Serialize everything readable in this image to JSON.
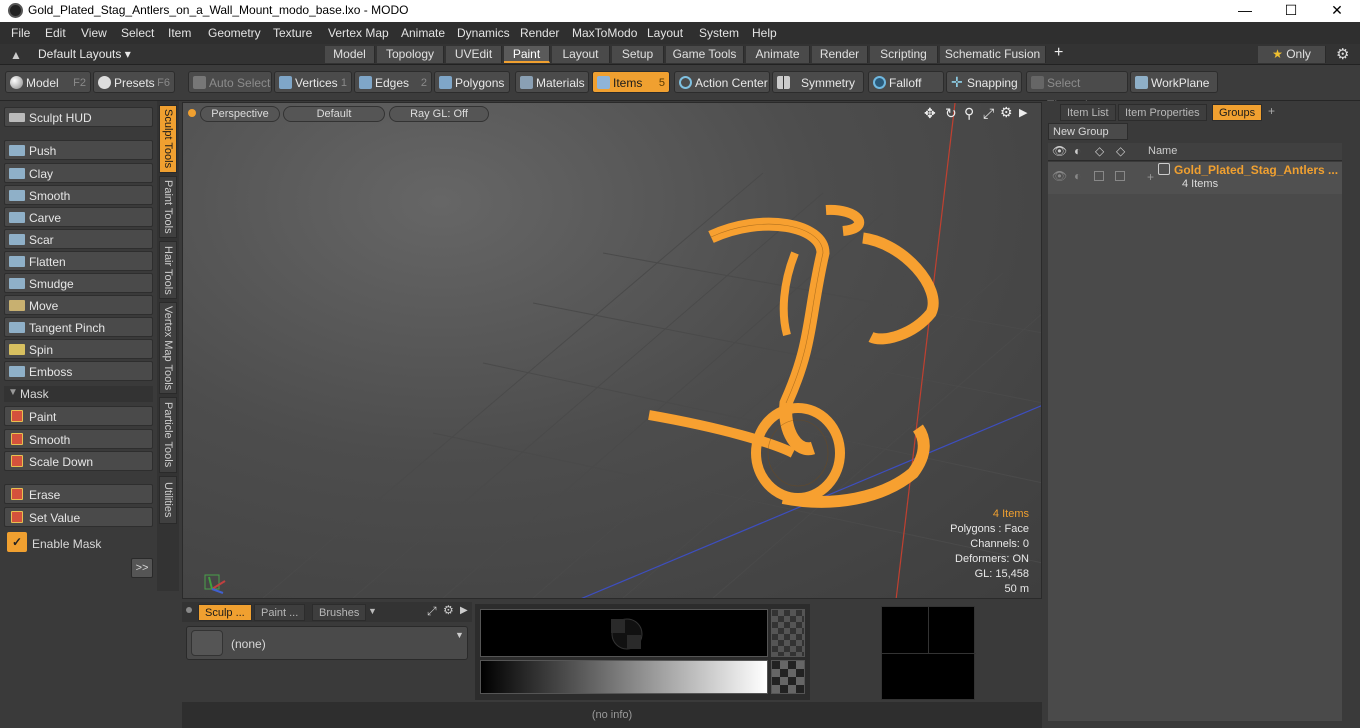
{
  "window": {
    "title": "Gold_Plated_Stag_Antlers_on_a_Wall_Mount_modo_base.lxo - MODO",
    "minimize": "—",
    "maximize": "☐",
    "close": "✕"
  },
  "menu": [
    "File",
    "Edit",
    "View",
    "Select",
    "Item",
    "Geometry",
    "Texture",
    "Vertex Map",
    "Animate",
    "Dynamics",
    "Render",
    "MaxToModo",
    "Layout",
    "System",
    "Help"
  ],
  "layouts": {
    "selector": "Default Layouts ▾",
    "tabs": [
      "Model",
      "Topology",
      "UVEdit",
      "Paint",
      "Layout",
      "Setup",
      "Game Tools",
      "Animate",
      "Render",
      "Scripting",
      "Schematic Fusion"
    ],
    "active": "Paint",
    "add": "+",
    "only": "Only"
  },
  "toolbar": {
    "model": "Model",
    "model_key": "F2",
    "presets": "Presets",
    "presets_key": "F6",
    "auto_select": "Auto Select",
    "vertices": "Vertices",
    "vertices_key": "1",
    "edges": "Edges",
    "edges_key": "2",
    "polygons": "Polygons",
    "materials": "Materials",
    "items": "Items",
    "items_key": "5",
    "action_center": "Action Center",
    "symmetry": "Symmetry",
    "falloff": "Falloff",
    "snapping": "Snapping",
    "select_through": "Select Through",
    "workplane": "WorkPlane"
  },
  "sculpt": {
    "hud": "Sculpt HUD",
    "tools": [
      "Push",
      "Clay",
      "Smooth",
      "Carve",
      "Scar",
      "Flatten",
      "Smudge",
      "Move",
      "Tangent Pinch",
      "Spin",
      "Emboss"
    ],
    "mask_header": "Mask",
    "mask_tools": [
      "Paint",
      "Smooth",
      "Scale Down"
    ],
    "erase": "Erase",
    "set_value": "Set Value",
    "enable_mask": "Enable Mask",
    "more": ">>"
  },
  "vertical_tabs": [
    "Sculpt Tools",
    "Paint Tools",
    "Hair Tools",
    "Vertex Map Tools",
    "Particle Tools",
    "Utilities"
  ],
  "viewport": {
    "view": "Perspective",
    "shading": "Default",
    "render": "Ray GL: Off",
    "hud": {
      "items": "4 Items",
      "polygons": "Polygons : Face",
      "channels": "Channels: 0",
      "deformers": "Deformers: ON",
      "gl": "GL: 15,458",
      "scale": "50 m"
    },
    "wire_color": "#f7a030"
  },
  "right_panel": {
    "tabs": [
      "Item List",
      "Item Properties",
      "Groups"
    ],
    "active_tab": "Groups",
    "add": "+",
    "new_group": "New Group",
    "column_name": "Name",
    "group_name": "Gold_Plated_Stag_Antlers ...",
    "group_count": "4 Items"
  },
  "bottom": {
    "tabs": [
      "Sculp ...",
      "Paint ...",
      "Brushes"
    ],
    "brush_value": "(none)"
  },
  "status": "(no info)"
}
